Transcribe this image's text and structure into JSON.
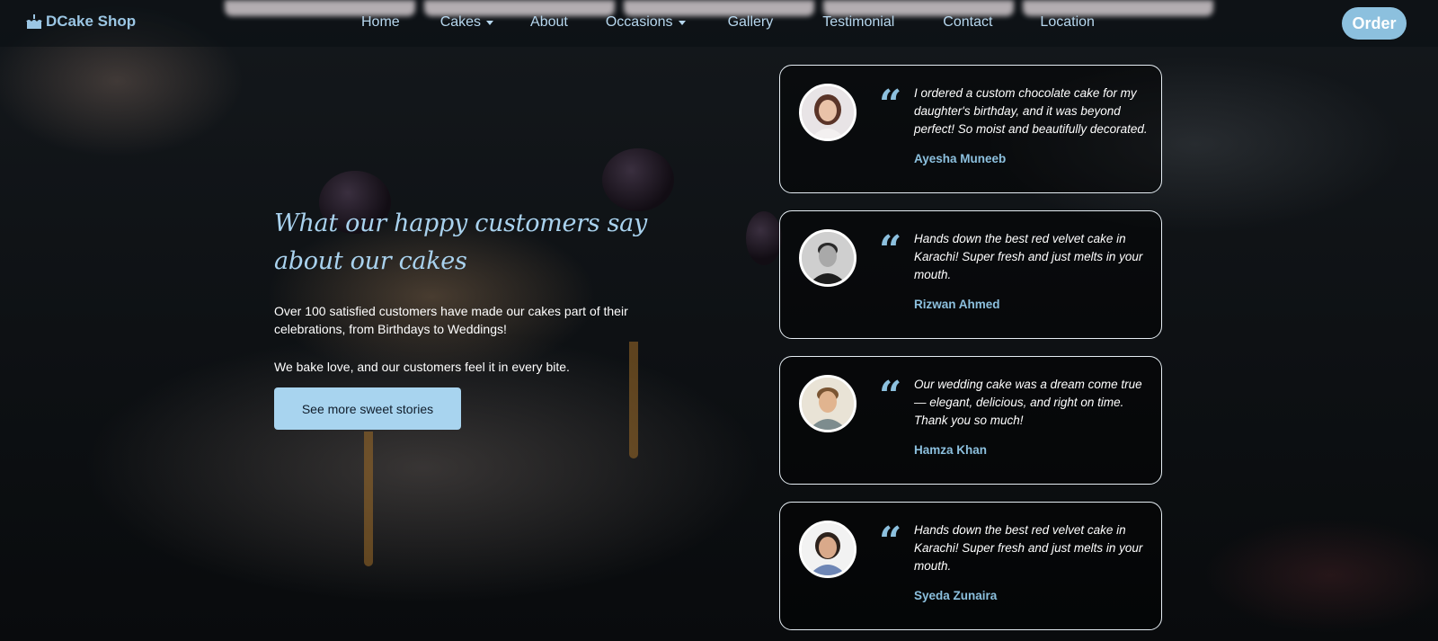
{
  "brand": {
    "name": "DCake Shop",
    "icon": "cake-icon",
    "accent": "#8cc0de"
  },
  "nav": {
    "links": [
      {
        "label": "Home",
        "has_dropdown": false
      },
      {
        "label": "Cakes",
        "has_dropdown": true
      },
      {
        "label": "About",
        "has_dropdown": false
      },
      {
        "label": "Occasions",
        "has_dropdown": true
      },
      {
        "label": "Gallery",
        "has_dropdown": false
      },
      {
        "label": "Testimonial",
        "has_dropdown": false
      },
      {
        "label": "Contact",
        "has_dropdown": false
      },
      {
        "label": "Location",
        "has_dropdown": false
      }
    ],
    "order_label": "Order"
  },
  "intro": {
    "heading": "What our happy customers say about our cakes",
    "paragraph1": "Over 100 satisfied customers have made our cakes part of their celebrations, from Birthdays to Weddings!",
    "paragraph2": "We bake love, and our customers feel it in every bite.",
    "button_label": "See more sweet stories"
  },
  "testimonials": [
    {
      "quote": "I ordered a custom chocolate cake for my daughter's birthday, and it was beyond perfect! So moist and beautifully decorated.",
      "author": "Ayesha Muneeb",
      "avatar_icon": "avatar-woman-icon"
    },
    {
      "quote": "Hands down the best red velvet cake in Karachi! Super fresh and just melts in your mouth.",
      "author": "Rizwan Ahmed",
      "avatar_icon": "avatar-man-icon"
    },
    {
      "quote": "Our wedding cake was a dream come true — elegant, delicious, and right on time. Thank you so much!",
      "author": "Hamza Khan",
      "avatar_icon": "avatar-man-icon"
    },
    {
      "quote": "Hands down the best red velvet cake in Karachi! Super fresh and just melts in your mouth.",
      "author": "Syeda Zunaira",
      "avatar_icon": "avatar-woman-icon"
    }
  ],
  "quote_glyph": "“"
}
